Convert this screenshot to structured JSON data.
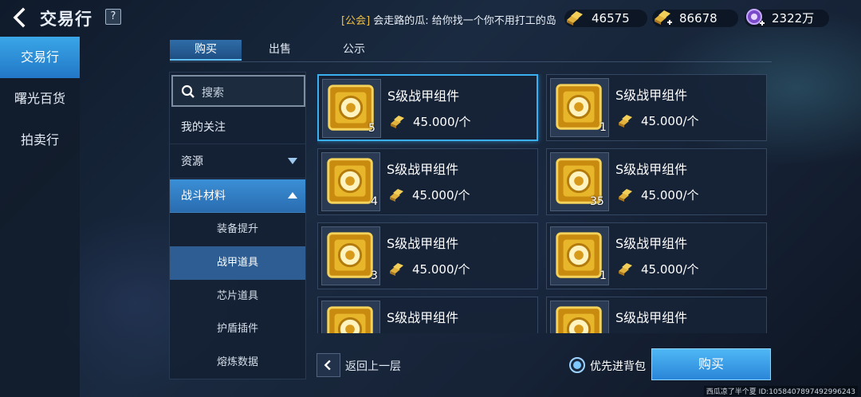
{
  "header": {
    "title": "交易行",
    "help": "?",
    "chat": {
      "tag": "[公会]",
      "text": " 会走路的瓜: 给你找一个你不用打工的岛"
    },
    "currencies": [
      {
        "icon": "gold-bars-icon",
        "value": "46575"
      },
      {
        "icon": "gold-bars-plus-icon",
        "value": "86678"
      },
      {
        "icon": "crystal-plus-icon",
        "value": "2322万"
      }
    ]
  },
  "left_nav": {
    "items": [
      {
        "label": "交易行"
      },
      {
        "label": "曙光百货"
      },
      {
        "label": "拍卖行"
      }
    ]
  },
  "tabs": [
    {
      "label": "购买"
    },
    {
      "label": "出售"
    },
    {
      "label": "公示"
    }
  ],
  "categories": {
    "search_placeholder": "搜索",
    "rows": [
      {
        "label": "我的关注"
      },
      {
        "label": "资源"
      },
      {
        "label": "战斗材料"
      }
    ],
    "subitems": [
      {
        "label": "装备提升"
      },
      {
        "label": "战甲道具"
      },
      {
        "label": "芯片道具"
      },
      {
        "label": "护盾插件"
      },
      {
        "label": "熔炼数据"
      }
    ]
  },
  "items": [
    {
      "name": "S级战甲组件",
      "price": "45.000/个",
      "qty": "5"
    },
    {
      "name": "S级战甲组件",
      "price": "45.000/个",
      "qty": "1"
    },
    {
      "name": "S级战甲组件",
      "price": "45.000/个",
      "qty": "4"
    },
    {
      "name": "S级战甲组件",
      "price": "45.000/个",
      "qty": "35"
    },
    {
      "name": "S级战甲组件",
      "price": "45.000/个",
      "qty": "3"
    },
    {
      "name": "S级战甲组件",
      "price": "45.000/个",
      "qty": "1"
    },
    {
      "name": "S级战甲组件",
      "price": "",
      "qty": ""
    },
    {
      "name": "S级战甲组件",
      "price": "",
      "qty": ""
    }
  ],
  "bottom": {
    "back_label": "返回上一层",
    "priority_label": "优先进背包",
    "buy_label": "购买"
  },
  "footer": "西瓜凉了半个夏 ID:1058407897492996243",
  "colors": {
    "accent": "#3aa6e8",
    "gold": "#f0c040"
  }
}
